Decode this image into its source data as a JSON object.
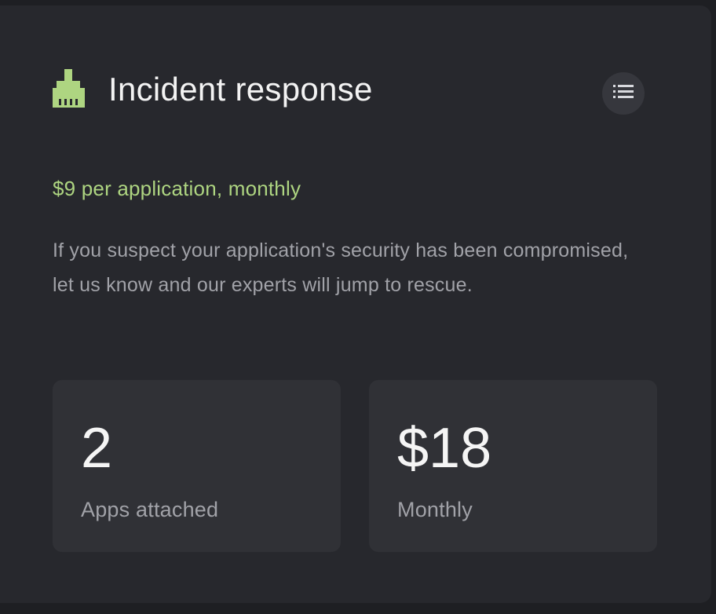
{
  "card": {
    "icon": "broom-icon",
    "title": "Incident response",
    "menu_icon": "list-icon",
    "price": "$9 per application, monthly",
    "description": "If you suspect your application's security has been compromised, let us know and our experts will jump to rescue.",
    "stats": [
      {
        "value": "2",
        "label": "Apps attached"
      },
      {
        "value": "$18",
        "label": "Monthly"
      }
    ]
  },
  "colors": {
    "accent": "#aed581",
    "card_background": "#27282d",
    "stat_background": "#303136",
    "page_background": "#1e1f23"
  }
}
